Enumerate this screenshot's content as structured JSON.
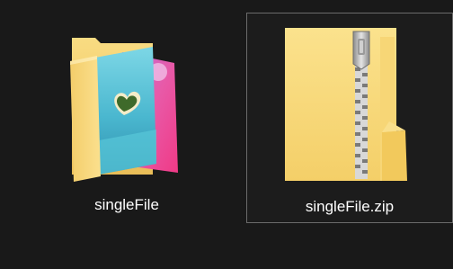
{
  "explorer": {
    "items": [
      {
        "name": "singleFile",
        "type": "folder",
        "icon": "folder-with-image-icon",
        "selected": false
      },
      {
        "name": "singleFile.zip",
        "type": "zip",
        "icon": "zip-folder-icon",
        "selected": true
      }
    ]
  },
  "colors": {
    "background": "#191919",
    "folder_yellow": "#f7d774",
    "folder_dark_yellow": "#e8b84a",
    "selection_border": "#6b6b6b",
    "label_text": "#ffffff"
  }
}
